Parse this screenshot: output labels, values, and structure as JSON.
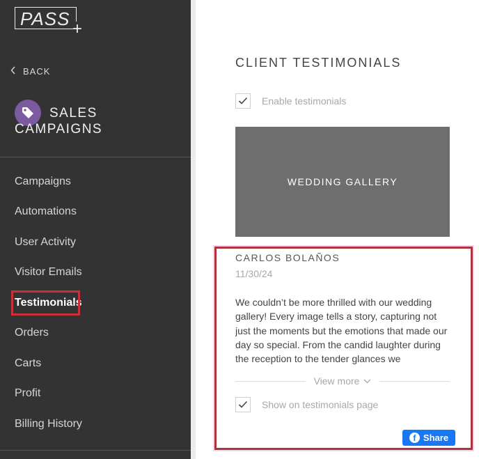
{
  "sidebar": {
    "logo_text": "PASS",
    "logo_plus": "+",
    "back_label": "BACK",
    "section_title": "SALES CAMPAIGNS",
    "items": [
      {
        "label": "Campaigns"
      },
      {
        "label": "Automations"
      },
      {
        "label": "User Activity"
      },
      {
        "label": "Visitor Emails"
      },
      {
        "label": "Testimonials",
        "active": true
      },
      {
        "label": "Orders"
      },
      {
        "label": "Carts"
      },
      {
        "label": "Profit"
      },
      {
        "label": "Billing History"
      }
    ]
  },
  "main": {
    "title": "CLIENT TESTIMONIALS",
    "enable_label": "Enable testimonials",
    "enable_checked": true,
    "gallery_label": "WEDDING GALLERY",
    "testimonial": {
      "name": "CARLOS BOLAÑOS",
      "date": "11/30/24",
      "text": "We couldn’t be more thrilled with our wedding gallery! Every image tells a story, capturing not just the moments but the emotions that made our day so special. From the candid laughter during the reception to the tender glances we",
      "view_more": "View more",
      "show_label": "Show on testimonials page",
      "show_checked": true,
      "share_label": "Share"
    }
  },
  "colors": {
    "sidebar_bg": "#333333",
    "tag_icon_bg": "#7c5aa0",
    "highlight": "#c8303a",
    "gallery_bg": "#6e6e6e",
    "share_bg": "#1877f2"
  }
}
